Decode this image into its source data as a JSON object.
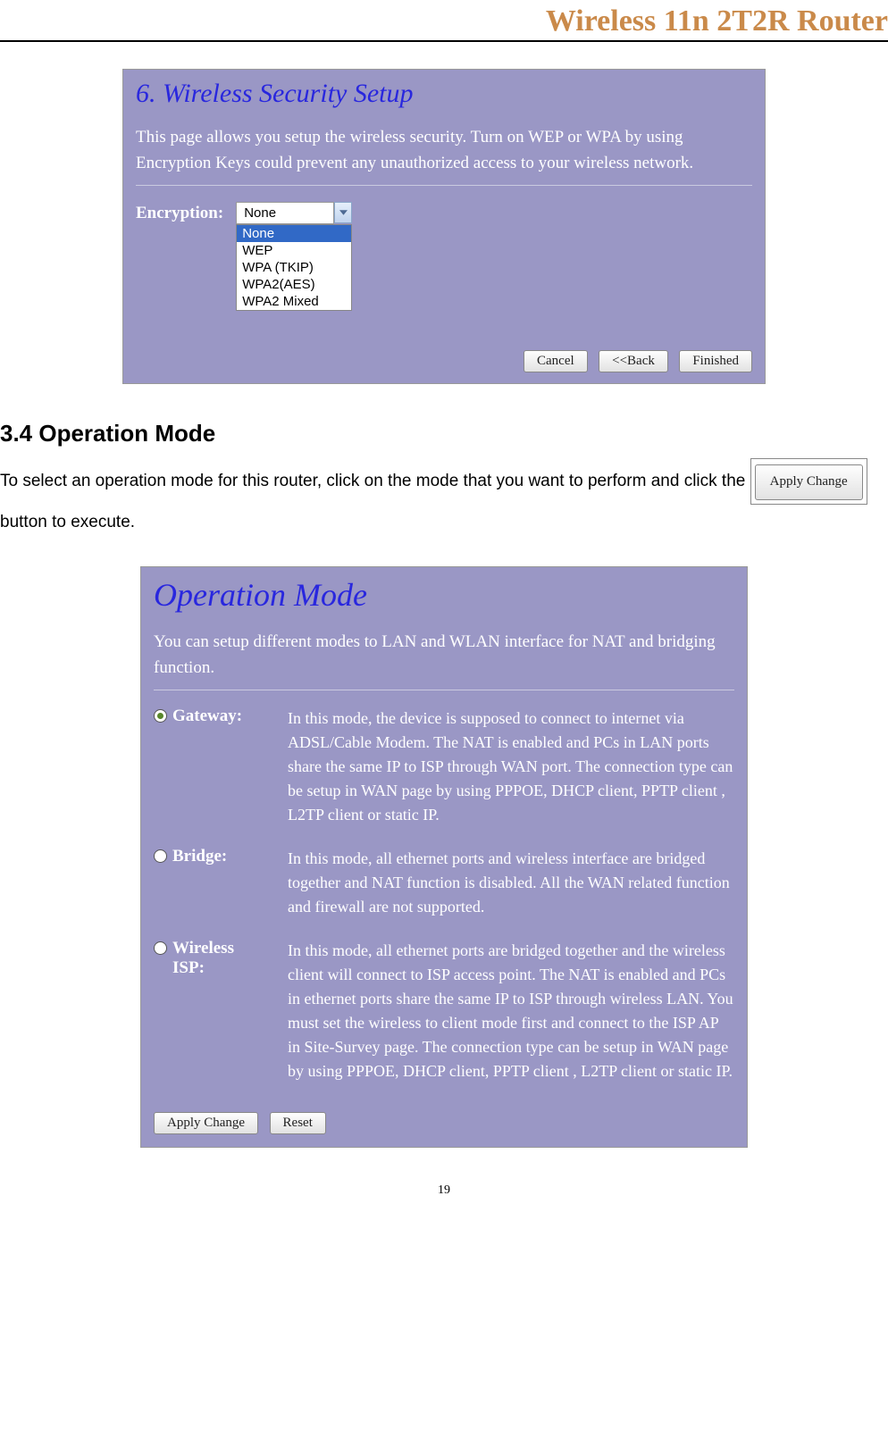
{
  "header": {
    "title": "Wireless 11n 2T2R Router"
  },
  "wizard": {
    "title": "6. Wireless Security Setup",
    "desc": "This page allows you setup the wireless security. Turn on WEP or WPA by using Encryption Keys could prevent any unauthorized access to your wireless network.",
    "encryption_label": "Encryption:",
    "selected": "None",
    "options": [
      "None",
      "WEP",
      "WPA (TKIP)",
      "WPA2(AES)",
      "WPA2 Mixed"
    ],
    "buttons": {
      "cancel": "Cancel",
      "back": "<<Back",
      "finished": "Finished"
    }
  },
  "section": {
    "heading": "3.4   Operation Mode",
    "para_before": "To select an operation mode for this router, click on the mode that you want to perform and click the ",
    "apply_btn": "Apply Change",
    "para_after": " button to execute."
  },
  "opmode": {
    "title": "Operation Mode",
    "desc": "You can setup different modes to LAN and WLAN interface for NAT and bridging function.",
    "modes": [
      {
        "label": "Gateway:",
        "selected": true,
        "text": "In this mode, the device is supposed to connect to internet via ADSL/Cable Modem. The NAT is enabled and PCs in LAN ports share the same IP to ISP through WAN port. The connection type can be setup in WAN page by using PPPOE, DHCP client, PPTP client , L2TP client or static IP."
      },
      {
        "label": "Bridge:",
        "selected": false,
        "text": "In this mode, all ethernet ports and wireless interface are bridged together and NAT function is disabled. All the WAN related function and firewall are not supported."
      },
      {
        "label": "Wireless ISP:",
        "selected": false,
        "text": "In this mode, all ethernet ports are bridged together and the wireless client will connect to ISP access point. The NAT is enabled and PCs in ethernet ports share the same IP to ISP through wireless LAN. You must set the wireless to client mode first and connect to the ISP AP in Site-Survey page. The connection type can be setup in WAN page by using PPPOE, DHCP client, PPTP client , L2TP client or static IP."
      }
    ],
    "buttons": {
      "apply": "Apply Change",
      "reset": "Reset"
    }
  },
  "page_number": "19"
}
